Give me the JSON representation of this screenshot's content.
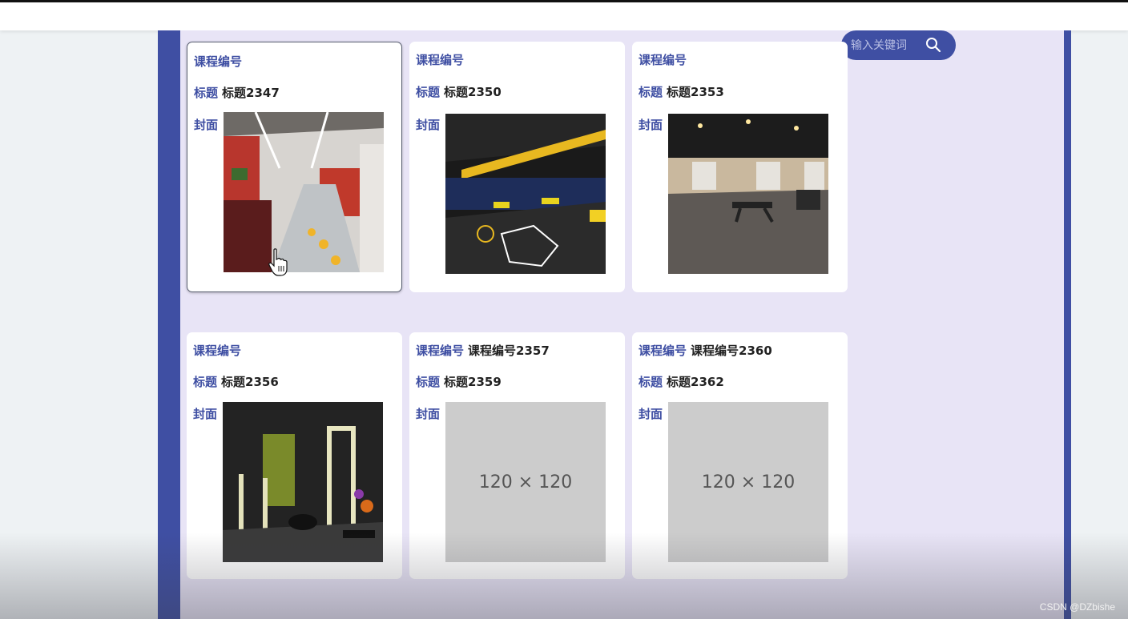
{
  "search": {
    "placeholder": "输入关键词"
  },
  "labels": {
    "course_no": "课程编号",
    "title": "标题",
    "cover": "封面"
  },
  "cards": [
    {
      "course_no": "",
      "title": "标题2347",
      "cover": "gym-corridor-photo"
    },
    {
      "course_no": "",
      "title": "标题2350",
      "cover": "gym-floor-photo"
    },
    {
      "course_no": "",
      "title": "标题2353",
      "cover": "gym-hall-photo"
    },
    {
      "course_no": "",
      "title": "标题2356",
      "cover": "gym-equipment-photo"
    },
    {
      "course_no": "课程编号2357",
      "title": "标题2359",
      "cover_placeholder": "120 × 120"
    },
    {
      "course_no": "课程编号2360",
      "title": "标题2362",
      "cover_placeholder": "120 × 120"
    }
  ],
  "watermark": "CSDN @DZbishe",
  "colors": {
    "accent": "#3f4fa3",
    "panel": "#e8e4f6",
    "placeholder": "#cccccc"
  }
}
